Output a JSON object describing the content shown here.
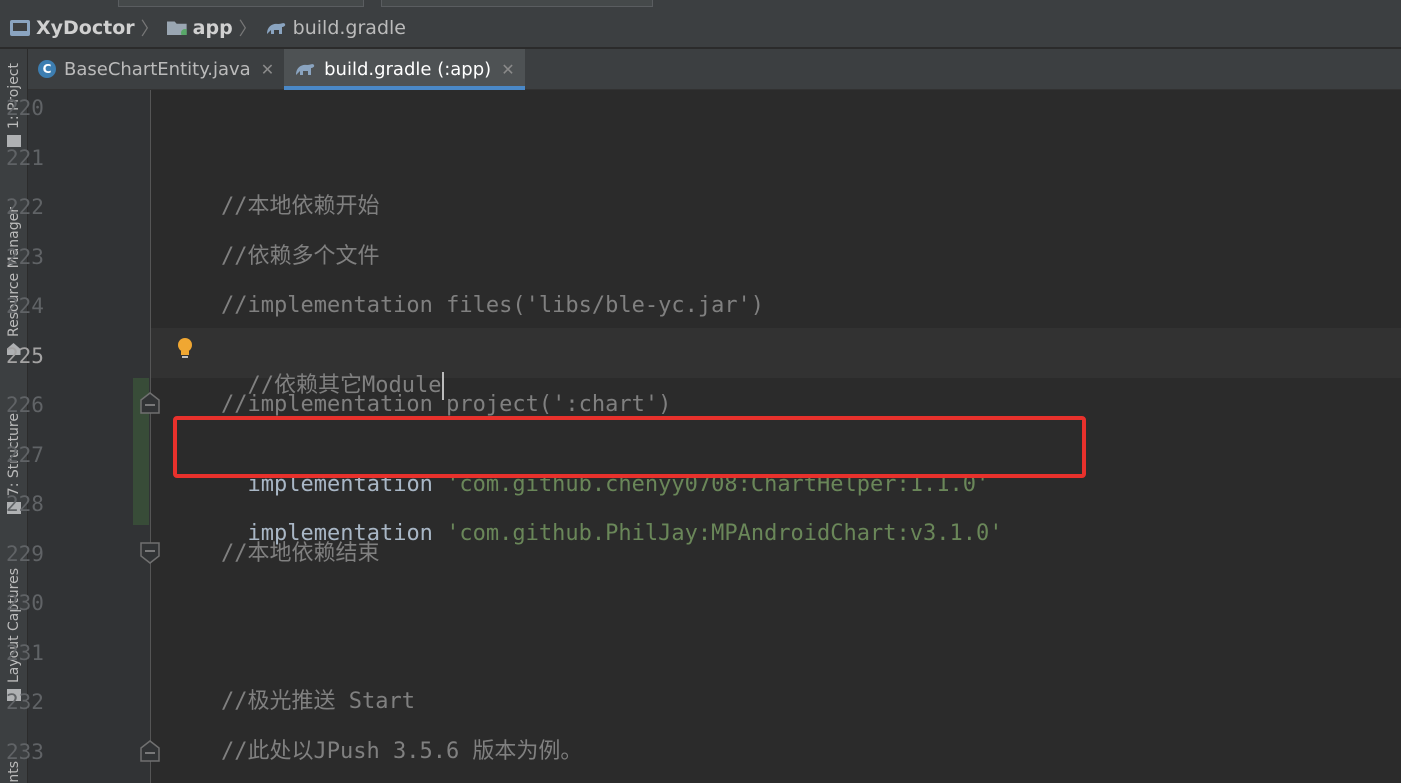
{
  "breadcrumb": {
    "project": "XyDoctor",
    "module": "app",
    "file": "build.gradle"
  },
  "tabs": [
    {
      "label": "BaseChartEntity.java",
      "icon": "java-class-icon",
      "active": false
    },
    {
      "label": "build.gradle (:app)",
      "icon": "gradle-icon",
      "active": true
    }
  ],
  "left_tools": {
    "project": "1: Project",
    "resource_manager": "Resource Manager",
    "structure": "7: Structure",
    "layout_captures": "Layout Captures",
    "cut_off": "nts"
  },
  "editor": {
    "current_line": "225",
    "lines": [
      {
        "no": "220",
        "text": ""
      },
      {
        "no": "221",
        "text": ""
      },
      {
        "no": "222",
        "text": "//本地依赖开始"
      },
      {
        "no": "223",
        "text": "//依赖多个文件"
      },
      {
        "no": "224",
        "text": "//implementation files('libs/ble-yc.jar')"
      },
      {
        "no": "225",
        "text": "//依赖其它Module"
      },
      {
        "no": "226",
        "text": "//implementation project(':chart')"
      },
      {
        "no": "227",
        "keyword": "implementation ",
        "string": "'com.github.chenyy0708:ChartHelper:1.1.0'"
      },
      {
        "no": "228",
        "keyword": "implementation ",
        "string": "'com.github.PhilJay:MPAndroidChart:v3.1.0'"
      },
      {
        "no": "229",
        "text": "//本地依赖结束"
      },
      {
        "no": "230",
        "text": ""
      },
      {
        "no": "231",
        "text": ""
      },
      {
        "no": "232",
        "text": "//极光推送 Start"
      },
      {
        "no": "233",
        "text": "//此处以JPush 3.5.6 版本为例。"
      }
    ]
  },
  "colors": {
    "background": "#2b2b2b",
    "comment": "#808080",
    "string": "#6a8759",
    "highlight": "#e8312c",
    "active_tab_underline": "#4a88c7"
  }
}
